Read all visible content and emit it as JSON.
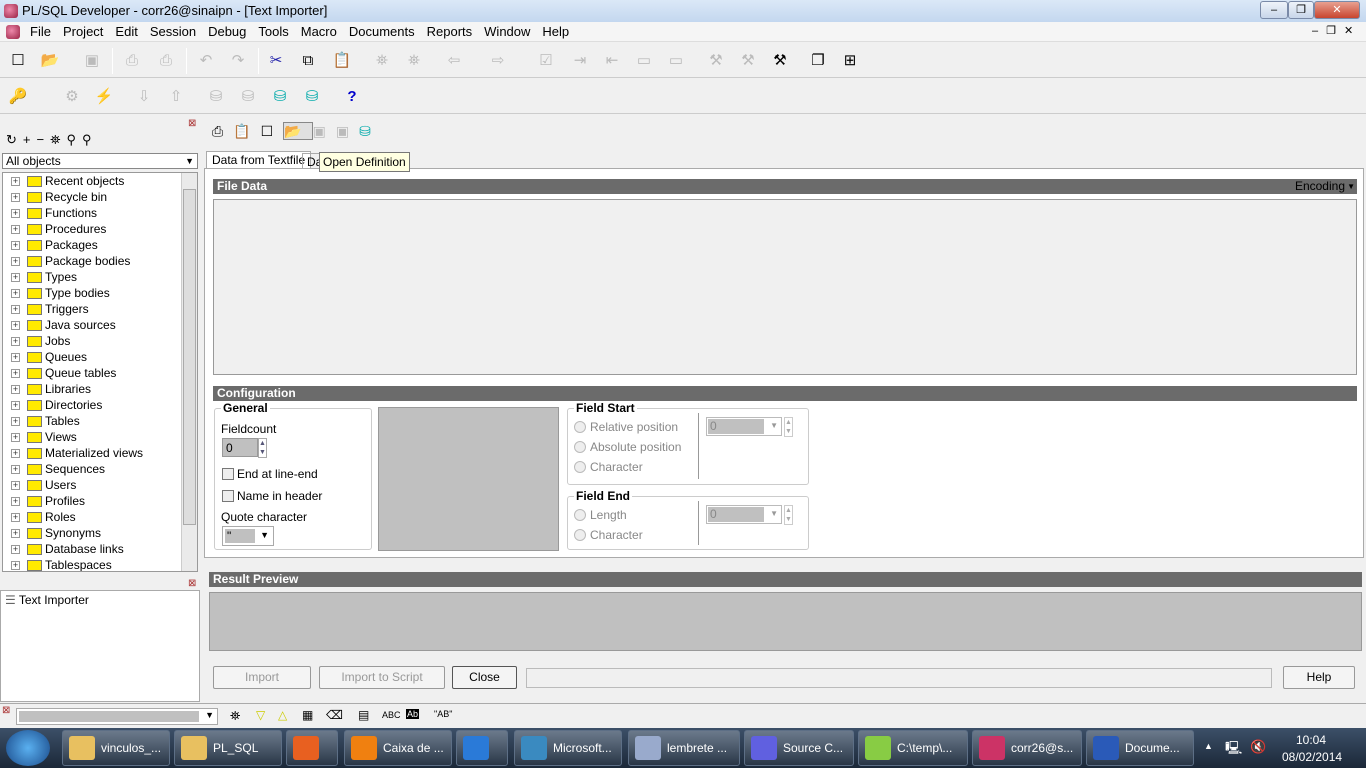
{
  "window": {
    "title": "PL/SQL Developer - corr26@sinaipn - [Text Importer]",
    "min": "‒",
    "max": "❐",
    "close": "✕"
  },
  "menu": [
    "File",
    "Project",
    "Edit",
    "Session",
    "Debug",
    "Tools",
    "Macro",
    "Documents",
    "Reports",
    "Window",
    "Help"
  ],
  "left": {
    "filter": "All objects",
    "tree": [
      "Recent objects",
      "Recycle bin",
      "Functions",
      "Procedures",
      "Packages",
      "Package bodies",
      "Types",
      "Type bodies",
      "Triggers",
      "Java sources",
      "Jobs",
      "Queues",
      "Queue tables",
      "Libraries",
      "Directories",
      "Tables",
      "Views",
      "Materialized views",
      "Sequences",
      "Users",
      "Profiles",
      "Roles",
      "Synonyms",
      "Database links",
      "Tablespaces"
    ],
    "windows": [
      "Text Importer"
    ]
  },
  "importer": {
    "tabs": [
      "Data from Textfile",
      "Da"
    ],
    "tooltip": "Open Definition",
    "file_data": "File Data",
    "encoding": "Encoding",
    "configuration": "Configuration",
    "general": {
      "title": "General",
      "fieldcount_label": "Fieldcount",
      "fieldcount": "0",
      "end_at_line_end": "End at line-end",
      "name_in_header": "Name in header",
      "quote_label": "Quote character",
      "quote": "\""
    },
    "field_start": {
      "title": "Field Start",
      "options": [
        "Relative position",
        "Absolute position",
        "Character"
      ],
      "value": "0"
    },
    "field_end": {
      "title": "Field End",
      "options": [
        "Length",
        "Character"
      ],
      "value": "0"
    },
    "result_preview": "Result Preview",
    "buttons": {
      "import": "Import",
      "import_script": "Import to Script",
      "close": "Close",
      "help": "Help"
    }
  },
  "findbar": {
    "abc": "ABC",
    "ab": "\"AB\""
  },
  "taskbar": {
    "items": [
      "vinculos_...",
      "PL_SQL",
      "",
      "Caixa de ...",
      "",
      "Microsoft...",
      "lembrete ...",
      "Source C...",
      "C:\\temp\\...",
      "corr26@s...",
      "Docume..."
    ],
    "time": "10:04",
    "date": "08/02/2014"
  }
}
